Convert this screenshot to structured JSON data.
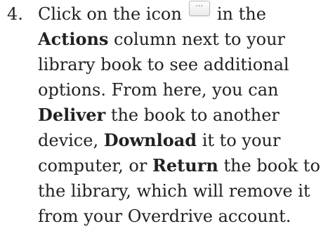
{
  "step": {
    "number": "4.",
    "icon": "more-options-ellipsis-icon",
    "icon_glyph": "···",
    "lines": {
      "l1a": "Click on the icon",
      "l1b": "in the",
      "l2a": "Actions",
      "l2b": " column next to your",
      "l3": "library book to see additional",
      "l4": "options. From here, you can",
      "l5a": "Deliver",
      "l5b": " the book to another",
      "l6a": "device, ",
      "l6b": "Download",
      "l6c": " it to your",
      "l7a": "computer, or ",
      "l7b": "Return",
      "l7c": " the book to",
      "l8": "the library, which will remove it",
      "l9": "from your Overdrive account."
    }
  }
}
